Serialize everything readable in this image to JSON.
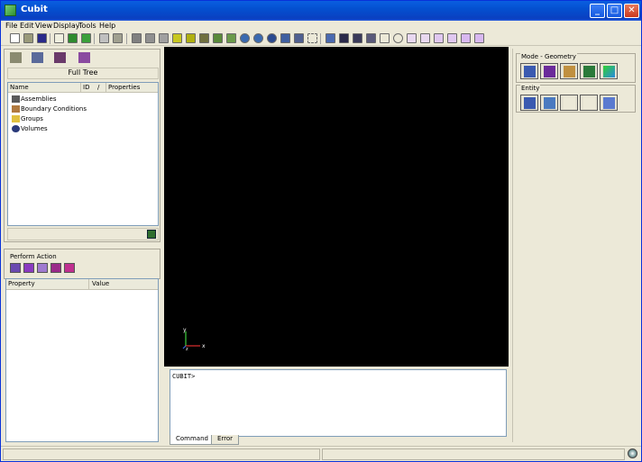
{
  "window": {
    "title": "Cubit",
    "icons": {
      "app": "cubit-icon",
      "minimize": "minimize-icon",
      "maximize": "maximize-icon",
      "close": "close-icon"
    },
    "minimize_glyph": "_",
    "maximize_glyph": "□",
    "close_glyph": "✕"
  },
  "menu": [
    "File",
    "Edit",
    "View",
    "Display",
    "Tools",
    "Help"
  ],
  "toolbar": {
    "groups": [
      [
        "new-file-icon",
        "open-file-icon",
        "save-icon"
      ],
      [
        "journal-icon",
        "play-icon",
        "pause-icon"
      ],
      [
        "flag-icon",
        "undo-icon"
      ],
      [
        "view-cube-iso-icon",
        "view-cube-front-icon",
        "view-cube-top-icon",
        "view-cube-right-icon",
        "view-cube-left-icon",
        "view-cube-back-icon",
        "view-cube-bottom-icon",
        "view-cube-persp-icon"
      ],
      [
        "zoom-in-icon",
        "zoom-out-icon",
        "rotate-icon",
        "fit-icon",
        "zoom-window-icon",
        "select-box-icon"
      ],
      [
        "render-hidden-icon",
        "render-shaded-icon",
        "render-wire-icon",
        "render-surface-icon"
      ],
      [
        "pick-line-icon",
        "pick-point-icon",
        "pick-cross-icon",
        "pick-horizontal-icon",
        "pick-box-icon",
        "pick-tri-icon",
        "pick-star-icon",
        "pick-plus-icon"
      ]
    ]
  },
  "tree_panel": {
    "tab_icons": [
      "tree-tab-icon",
      "volume-tab-icon",
      "mesh-tab-icon",
      "pin-tab-icon"
    ],
    "title": "Full Tree",
    "columns": [
      "Name",
      "ID",
      "/",
      "Properties"
    ],
    "items": [
      {
        "label": "Assemblies",
        "icon": "assembly-icon"
      },
      {
        "label": "Boundary Conditions",
        "icon": "boundary-icon"
      },
      {
        "label": "Groups",
        "icon": "group-icon"
      },
      {
        "label": "Volumes",
        "icon": "volume-icon"
      }
    ]
  },
  "action_panel": {
    "label": "Perform Action",
    "buttons": [
      "action-chart-icon",
      "action-pencil-icon",
      "action-mesh-icon",
      "action-grid-icon",
      "action-delete-icon"
    ]
  },
  "property_table": {
    "columns": [
      "Property",
      "Value"
    ]
  },
  "axes": {
    "x": "x",
    "y": "y",
    "z": "z"
  },
  "command": {
    "prompt": "CUBIT>",
    "tabs": [
      "Command",
      "Error"
    ],
    "active_tab": "Command"
  },
  "right_panel": {
    "mode_group": {
      "label": "Mode - Geometry",
      "buttons": [
        "geometry-mode-icon",
        "mesh-mode-icon",
        "bc-mode-icon",
        "export-mode-icon",
        "analysis-mode-icon"
      ]
    },
    "entity_group": {
      "label": "Entity",
      "buttons": [
        "volume-entity-icon",
        "surface-entity-icon",
        "curve-entity-icon",
        "vertex-entity-icon",
        "body-entity-icon"
      ]
    }
  },
  "status_bar": {
    "icon": "status-globe-icon"
  },
  "colors": {
    "viewport_bg": "#000000",
    "title_bar": "#0a50d0",
    "panel_bg": "#ece9d8"
  }
}
